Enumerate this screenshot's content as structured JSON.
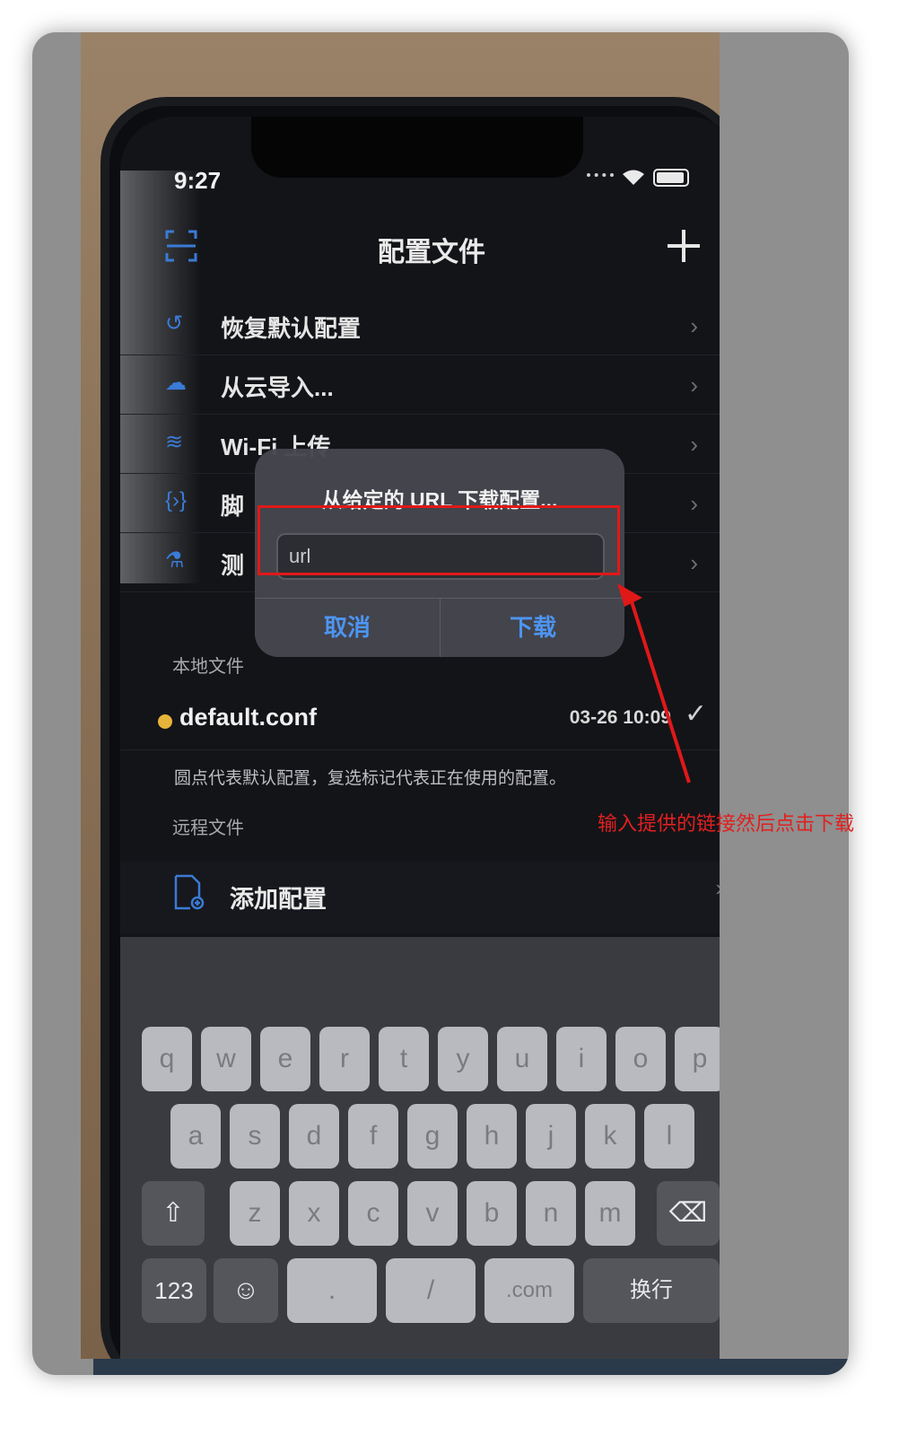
{
  "status": {
    "time": "9:27"
  },
  "nav": {
    "title": "配置文件"
  },
  "menu": [
    {
      "label": "恢复默认配置",
      "icon": "restore-icon"
    },
    {
      "label": "从云导入...",
      "icon": "cloud-icon"
    },
    {
      "label": "Wi-Fi 上传",
      "icon": "wifi-upload-icon"
    },
    {
      "label": "脚",
      "icon": "script-icon"
    },
    {
      "label": "测",
      "icon": "test-flask-icon"
    }
  ],
  "dialog": {
    "title": "从给定的 URL 下载配置...",
    "placeholder": "url",
    "cancel": "取消",
    "download": "下载"
  },
  "local": {
    "section": "本地文件",
    "file_name": "default.conf",
    "file_date": "03-26 10:09",
    "hint": "圆点代表默认配置，复选标记代表正在使用的配置。"
  },
  "remote": {
    "section": "远程文件",
    "add_label": "添加配置"
  },
  "keyboard": {
    "row1": [
      "q",
      "w",
      "e",
      "r",
      "t",
      "y",
      "u",
      "i",
      "o",
      "p"
    ],
    "row2": [
      "a",
      "s",
      "d",
      "f",
      "g",
      "h",
      "j",
      "k",
      "l"
    ],
    "row3": [
      "z",
      "x",
      "c",
      "v",
      "b",
      "n",
      "m"
    ],
    "num_key": "123",
    "slash": "/",
    "dot": ".",
    "dotcom": ".com",
    "return": "换行"
  },
  "annotation": {
    "text": "输入提供的链接然后点击下载"
  },
  "colors": {
    "accent": "#4d95f2",
    "highlight": "#e01818",
    "default_dot": "#e7b43a"
  }
}
